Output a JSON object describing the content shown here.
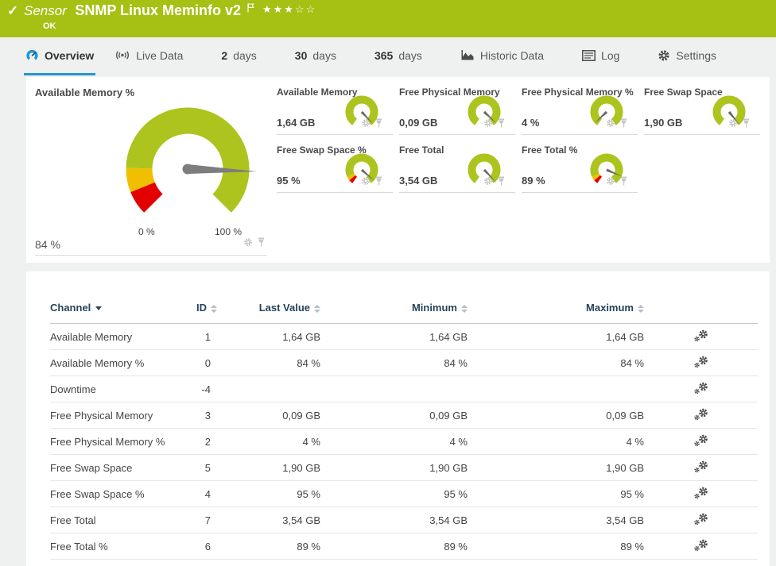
{
  "header": {
    "type_label": "Sensor",
    "title": "SNMP Linux Meminfo v2",
    "status": "OK",
    "stars": "★★★☆☆"
  },
  "tabs": [
    {
      "label": "Overview",
      "active": true
    },
    {
      "label": "Live Data"
    },
    {
      "prefix": "2",
      "label": "days"
    },
    {
      "prefix": "30",
      "label": "days"
    },
    {
      "prefix": "365",
      "label": "days"
    },
    {
      "label": "Historic Data"
    },
    {
      "label": "Log"
    },
    {
      "label": "Settings"
    }
  ],
  "big_gauge": {
    "label": "Available Memory %",
    "value": "84 %",
    "scale_min": "0 %",
    "scale_max": "100 %",
    "needle_deg": 92,
    "has_limit_segments": true
  },
  "small_gauges": [
    {
      "label": "Available Memory",
      "value": "1,64 GB",
      "needle_deg": 137,
      "has_limit_segments": false
    },
    {
      "label": "Free Physical Memory",
      "value": "0,09 GB",
      "needle_deg": 133,
      "has_limit_segments": false
    },
    {
      "label": "Free Physical Memory %",
      "value": "4 %",
      "needle_deg": 227,
      "has_limit_segments": false
    },
    {
      "label": "Free Swap Space",
      "value": "1,90 GB",
      "needle_deg": 141,
      "has_limit_segments": false
    },
    {
      "label": "Free Swap Space %",
      "value": "95 %",
      "needle_deg": 131,
      "has_limit_segments": true
    },
    {
      "label": "Free Total",
      "value": "3,54 GB",
      "needle_deg": 136,
      "has_limit_segments": false
    },
    {
      "label": "Free Total %",
      "value": "89 %",
      "needle_deg": 113,
      "has_limit_segments": true
    }
  ],
  "channel_table": {
    "columns": {
      "channel": "Channel",
      "id": "ID",
      "last": "Last Value",
      "min": "Minimum",
      "max": "Maximum"
    },
    "rows": [
      {
        "channel": "Available Memory",
        "id": "1",
        "last": "1,64 GB",
        "min": "1,64 GB",
        "max": "1,64 GB"
      },
      {
        "channel": "Available Memory %",
        "id": "0",
        "last": "84 %",
        "min": "84 %",
        "max": "84 %"
      },
      {
        "channel": "Downtime",
        "id": "-4",
        "last": "",
        "min": "",
        "max": ""
      },
      {
        "channel": "Free Physical Memory",
        "id": "3",
        "last": "0,09 GB",
        "min": "0,09 GB",
        "max": "0,09 GB"
      },
      {
        "channel": "Free Physical Memory %",
        "id": "2",
        "last": "4 %",
        "min": "4 %",
        "max": "4 %"
      },
      {
        "channel": "Free Swap Space",
        "id": "5",
        "last": "1,90 GB",
        "min": "1,90 GB",
        "max": "1,90 GB"
      },
      {
        "channel": "Free Swap Space %",
        "id": "4",
        "last": "95 %",
        "min": "95 %",
        "max": "95 %"
      },
      {
        "channel": "Free Total",
        "id": "7",
        "last": "3,54 GB",
        "min": "3,54 GB",
        "max": "3,54 GB"
      },
      {
        "channel": "Free Total %",
        "id": "6",
        "last": "89 %",
        "min": "89 %",
        "max": "89 %"
      }
    ]
  },
  "colors": {
    "ok_green": "#a6c013",
    "gauge_green": "#adc41e",
    "gauge_yellow": "#f0c000",
    "gauge_red": "#e30000",
    "accent_blue": "#2196d3",
    "table_header_text": "#26435a"
  }
}
